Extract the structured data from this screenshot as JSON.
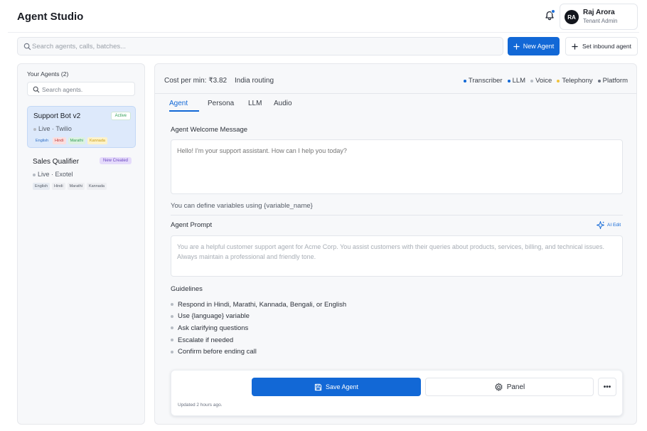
{
  "header": {
    "app_title": "Agent Studio",
    "user": {
      "initials": "RA",
      "name": "Raj Arora",
      "role": "Tenant Admin"
    }
  },
  "toolbar": {
    "search_placeholder": "Search agents, calls, batches...",
    "new_agent_label": "New Agent",
    "inbound_label": "Set inbound agent"
  },
  "sidebar": {
    "heading": "Your Agents (2)",
    "search_placeholder": "Search agents.",
    "agents": [
      {
        "name": "Support Bot v2",
        "badge": "Active",
        "status": "Live · Twilio",
        "tags": [
          {
            "label": "English",
            "bg": "#dbe9fb",
            "fg": "#2d6bc4"
          },
          {
            "label": "Hindi",
            "bg": "#fbdede",
            "fg": "#c03a3a"
          },
          {
            "label": "Marathi",
            "bg": "#dcf2e1",
            "fg": "#2f9e55"
          },
          {
            "label": "Kannada",
            "bg": "#fdf3c9",
            "fg": "#c99a12"
          }
        ]
      },
      {
        "name": "Sales Qualifier",
        "badge": "New Created",
        "status": "Live · Exotel",
        "tags": [
          {
            "label": "English",
            "bg": "#e6ebf2",
            "fg": "#545b66"
          },
          {
            "label": "Hindi",
            "bg": "#eeeff2",
            "fg": "#545b66"
          },
          {
            "label": "Marathi",
            "bg": "#eeeff2",
            "fg": "#545b66"
          },
          {
            "label": "Kannada",
            "bg": "#eeeff2",
            "fg": "#545b66"
          }
        ]
      }
    ]
  },
  "main": {
    "cost": "Cost per min: ₹3.82",
    "routing": "India routing",
    "legend": [
      {
        "label": "Transcriber",
        "color": "#1268d6"
      },
      {
        "label": "LLM",
        "color": "#1268d6"
      },
      {
        "label": "Voice",
        "color": "#b6bbc3"
      },
      {
        "label": "Telephony",
        "color": "#f0c23b"
      },
      {
        "label": "Platform",
        "color": "#6b7280"
      }
    ],
    "tabs": [
      "Agent",
      "Persona",
      "LLM",
      "Audio"
    ],
    "welcome_label": "Agent Welcome Message",
    "welcome_placeholder": "Hello! I'm your support assistant. How can I help you today?",
    "variables_hint": "You can define variables using {variable_name}",
    "prompt_label": "Agent Prompt",
    "ai_edit_label": "AI Edit",
    "prompt_text": "You are a helpful customer support agent for Acme Corp. You assist customers with their queries about products, services, billing, and technical issues. Always maintain a professional and friendly tone.",
    "guidelines_label": "Guidelines",
    "guidelines": [
      "Respond in Hindi, Marathi, Kannada, Bengali, or English",
      "Use {language} variable",
      "Ask clarifying questions",
      "Escalate if needed",
      "Confirm before ending call"
    ],
    "save_label": "Save Agent",
    "panel_label": "Panel",
    "more_label": "•••",
    "updated": "Updated 2 hours ago."
  }
}
